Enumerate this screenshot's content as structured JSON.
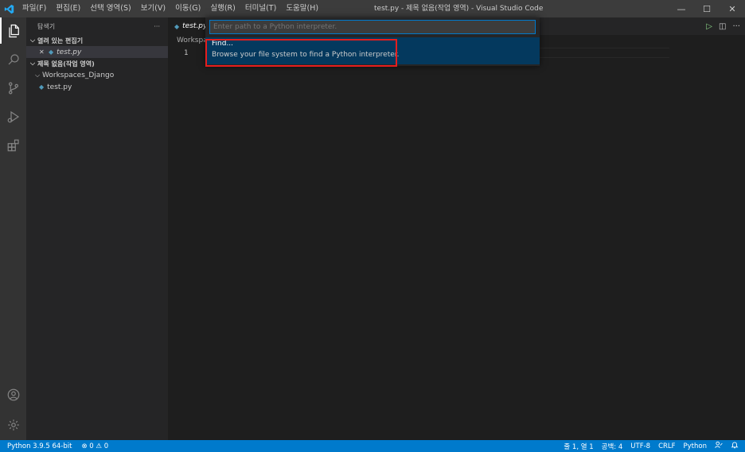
{
  "titlebar": {
    "menus": [
      "파일(F)",
      "편집(E)",
      "선택 영역(S)",
      "보기(V)",
      "이동(G)",
      "실행(R)",
      "터미널(T)",
      "도움말(H)"
    ],
    "window_title": "test.py - 제목 없음(작업 영역) - Visual Studio Code",
    "minimize": "—",
    "maximize": "☐",
    "close": "✕"
  },
  "activitybar": {
    "icons": [
      "files-icon",
      "search-icon",
      "source-control-icon",
      "run-debug-icon",
      "extensions-icon",
      "accounts-icon",
      "manage-gear-icon"
    ]
  },
  "sidebar": {
    "header": "탐색기",
    "more": "···",
    "open_editors_title": "열려 있는 편집기",
    "open_editor_close": "✕",
    "open_editor_file": "test.py",
    "workspace_title": "제목 없음(작업 영역)",
    "folder": "Workspaces_Django",
    "file": "test.py"
  },
  "editor": {
    "tab_label": "test.py",
    "breadcrumb": "Workspac",
    "line_number": "1",
    "actions": {
      "run": "▷",
      "split": "◫",
      "more": "···"
    }
  },
  "quick_input": {
    "placeholder": "Enter path to a Python interpreter.",
    "item_label": "Find...",
    "item_detail": "Browse your file system to find a Python interpreter."
  },
  "statusbar": {
    "interpreter": "Python 3.9.5 64-bit",
    "errors": "0",
    "warnings": "0",
    "position": "줄 1, 열 1",
    "spaces": "공백: 4",
    "encoding": "UTF-8",
    "eol": "CRLF",
    "language": "Python"
  },
  "colors": {
    "accent": "#007acc",
    "highlight_box": "#e51e1e",
    "selection": "#04395e"
  }
}
